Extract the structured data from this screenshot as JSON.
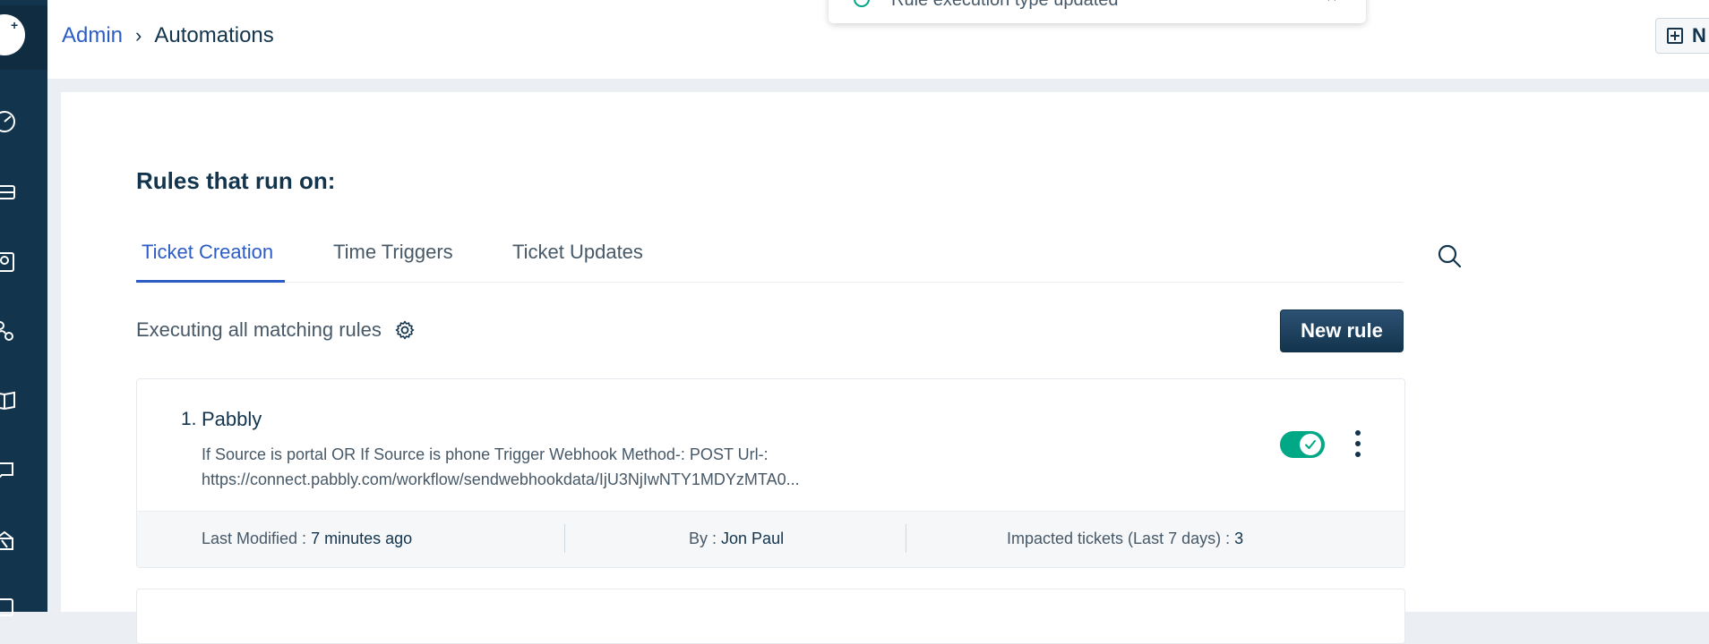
{
  "breadcrumb": {
    "parent": "Admin",
    "separator": "›",
    "current": "Automations"
  },
  "toast": {
    "message": "Rule execution type updated"
  },
  "header_button": {
    "label": "N"
  },
  "sidebar": {
    "icons": [
      "dashboard-icon",
      "tickets-icon",
      "contacts-icon",
      "groups-icon",
      "solutions-icon",
      "forums-icon",
      "reports-icon",
      "admin-icon"
    ]
  },
  "main": {
    "section_title": "Rules that run on:",
    "tabs": [
      {
        "label": "Ticket Creation",
        "active": true
      },
      {
        "label": "Time Triggers",
        "active": false
      },
      {
        "label": "Ticket Updates",
        "active": false
      }
    ],
    "execution_text": "Executing all matching rules",
    "new_rule_label": "New rule"
  },
  "rules": [
    {
      "number": "1.",
      "name": "Pabbly",
      "description_line1": "If Source is portal OR If Source is phone Trigger Webhook Method-: POST Url-:",
      "description_line2": "https://connect.pabbly.com/workflow/sendwebhookdata/IjU3NjIwNTY1MDYzMTA0...",
      "enabled": true,
      "last_modified_label": "Last Modified :",
      "last_modified_value": "7 minutes ago",
      "by_label": "By :",
      "by_value": "Jon Paul",
      "impacted_label": "Impacted tickets (Last 7 days) :",
      "impacted_value": "3"
    }
  ],
  "colors": {
    "sidebar": "#12344d",
    "accent": "#2c5cc5",
    "toggle_on": "#00a886",
    "primary_button": "#12344d"
  }
}
